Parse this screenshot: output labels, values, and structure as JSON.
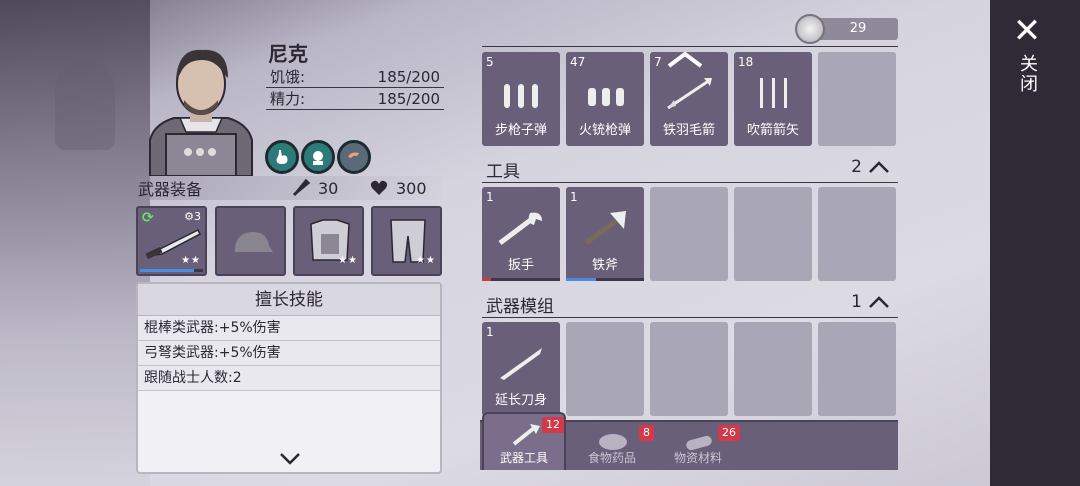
{
  "close": {
    "icon": "close-icon",
    "label": "关闭"
  },
  "character": {
    "name": "尼克",
    "hunger_label": "饥饿:",
    "hunger_value": "185/200",
    "energy_label": "精力:",
    "energy_value": "185/200",
    "status_icons": [
      "stomach-icon",
      "mood-icon",
      "shrimp-icon"
    ]
  },
  "equipment": {
    "title": "武器装备",
    "attack": "30",
    "health": "300",
    "slots": [
      {
        "item": "machete",
        "gear": "3",
        "stars": "★★",
        "durability": 0.85
      },
      {
        "item": "cap",
        "stars": ""
      },
      {
        "item": "armor-vest",
        "stars": "★★"
      },
      {
        "item": "pants",
        "stars": "★★"
      }
    ]
  },
  "skills": {
    "title": "擅长技能",
    "rows": [
      "棍棒类武器:+5%伤害",
      "弓弩类武器:+5%伤害",
      "跟随战士人数:2"
    ]
  },
  "coins": "29",
  "ammo": [
    {
      "count": "5",
      "label": "步枪子弹"
    },
    {
      "count": "47",
      "label": "火铳枪弹"
    },
    {
      "count": "7",
      "label": "铁羽毛箭"
    },
    {
      "count": "18",
      "label": "吹箭箭矢"
    }
  ],
  "tools": {
    "title": "工具",
    "count": "2",
    "items": [
      {
        "count": "1",
        "label": "扳手",
        "durability": 0.12,
        "color": "#d13a3a"
      },
      {
        "count": "1",
        "label": "铁斧",
        "durability": 0.38,
        "color": "#4b8be0"
      }
    ]
  },
  "mods": {
    "title": "武器模组",
    "count": "1",
    "items": [
      {
        "count": "1",
        "label": "延长刀身"
      }
    ]
  },
  "tabs": [
    {
      "label": "武器工具",
      "badge": "12"
    },
    {
      "label": "食物药品",
      "badge": "8"
    },
    {
      "label": "物资材料",
      "badge": "26"
    }
  ]
}
